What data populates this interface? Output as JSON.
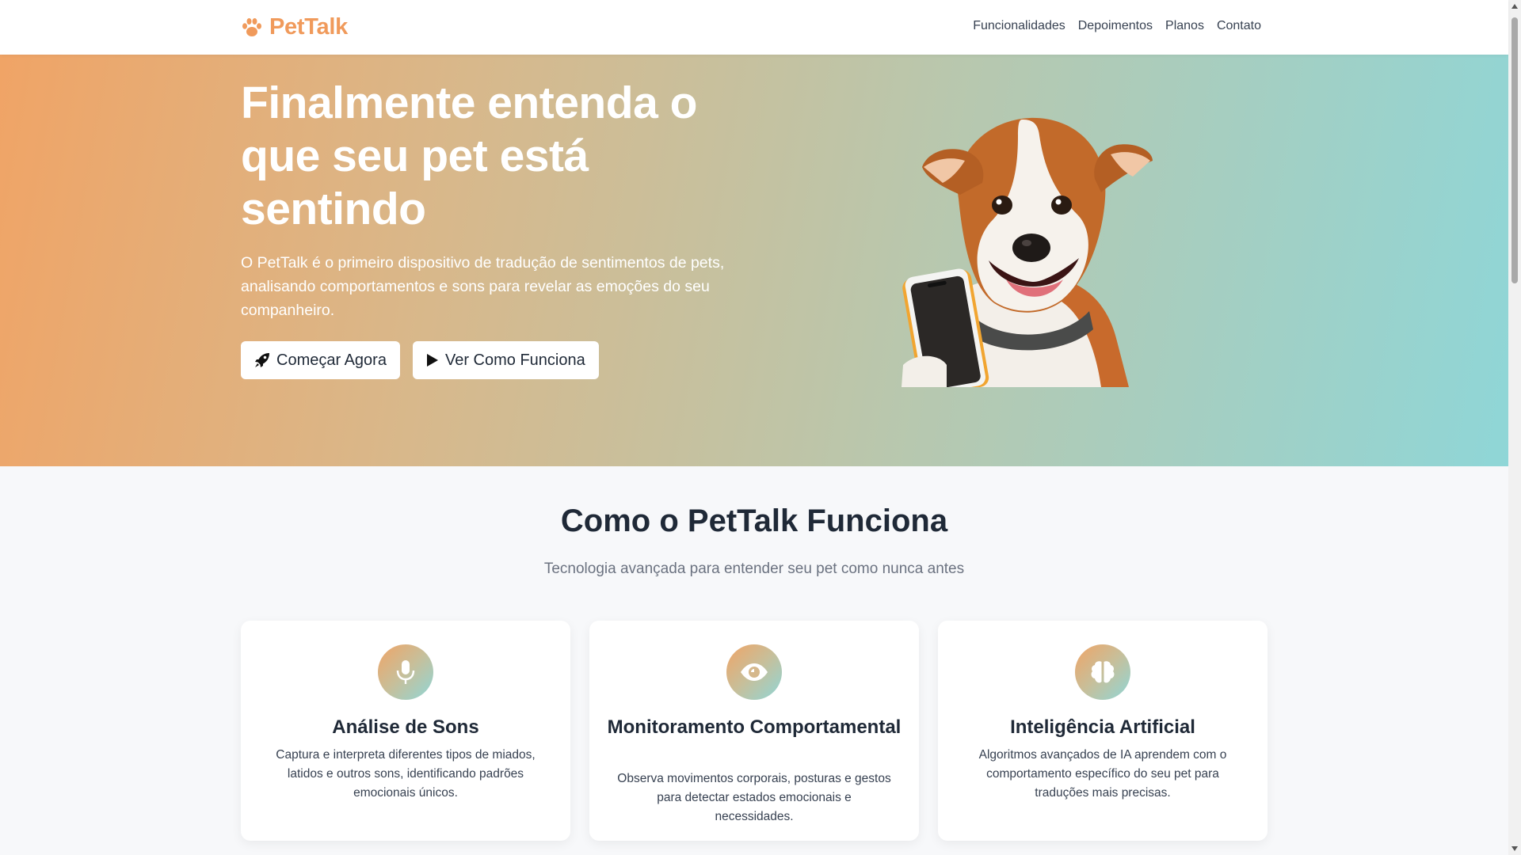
{
  "brand": {
    "name": "PetTalk",
    "icon": "paw-icon",
    "color": "#f09a5b"
  },
  "nav": {
    "items": [
      {
        "label": "Funcionalidades"
      },
      {
        "label": "Depoimentos"
      },
      {
        "label": "Planos"
      },
      {
        "label": "Contato"
      }
    ]
  },
  "hero": {
    "title": "Finalmente entenda o que seu pet está sentindo",
    "description": "O PetTalk é o primeiro dispositivo de tradução de sentimentos de pets, analisando comportamentos e sons para revelar as emoções do seu companheiro.",
    "primary_button": {
      "label": "Começar Agora",
      "icon": "rocket-icon"
    },
    "secondary_button": {
      "label": "Ver Como Funciona",
      "icon": "play-icon"
    },
    "image": "dog-with-phone-illustration",
    "gradient": [
      "#f0a466",
      "#8fd6d7"
    ]
  },
  "features": {
    "title": "Como o PetTalk Funciona",
    "subtitle": "Tecnologia avançada para entender seu pet como nunca antes",
    "cards": [
      {
        "icon": "microphone-icon",
        "title": "Análise de Sons",
        "description": "Captura e interpreta diferentes tipos de miados, latidos e outros sons, identificando padrões emocionais únicos."
      },
      {
        "icon": "eye-icon",
        "title": "Monitoramento Comportamental",
        "description": "Observa movimentos corporais, posturas e gestos para detectar estados emocionais e necessidades."
      },
      {
        "icon": "brain-icon",
        "title": "Inteligência Artificial",
        "description": "Algoritmos avançados de IA aprendem com o comportamento específico do seu pet para traduções mais precisas."
      }
    ]
  }
}
